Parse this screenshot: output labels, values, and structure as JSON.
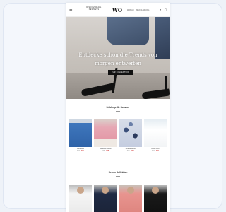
{
  "header": {
    "menu_icon": "menu-icon",
    "tagline": "DISCOVER ALL NEWNESS",
    "logo": "WO",
    "nav": [
      "WOMAN",
      "MEN KLEIDUNG"
    ],
    "icons": [
      "search-icon",
      "account-icon",
      "cart-icon"
    ]
  },
  "hero": {
    "title": "Entdecke schon die Trends von morgen entwerfen",
    "button": "ZUR KOLLEKTION"
  },
  "section1": {
    "title": "Lieblinge für Sommer",
    "products": [
      {
        "name": "Kleid Blau",
        "old": "€29",
        "new": "€19"
      },
      {
        "name": "Set Rosa Damen",
        "old": "€35",
        "new": "€25"
      },
      {
        "name": "Blumen Hemd",
        "old": "€30",
        "new": "€22"
      },
      {
        "name": "Bluse Weiß",
        "old": "€32",
        "new": "€24"
      }
    ]
  },
  "section2": {
    "title": "Herren Kollektion"
  },
  "colors": {
    "sale": "#d23b3b",
    "accent": "#111111"
  }
}
